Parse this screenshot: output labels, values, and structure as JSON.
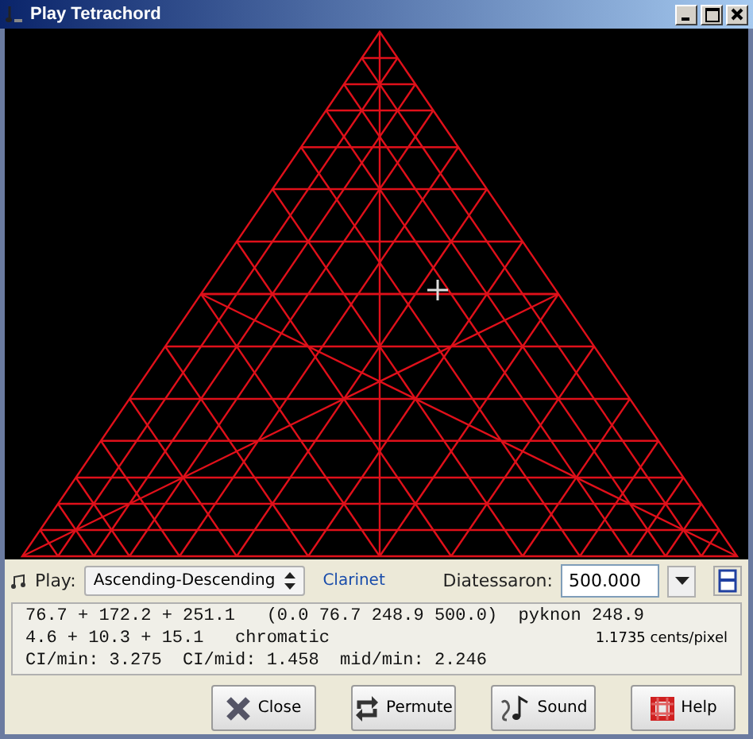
{
  "window": {
    "title": "Play Tetrachord"
  },
  "controls": {
    "play_label": "Play:",
    "mode": "Ascending-Descending",
    "instrument": "Clarinet",
    "diatessaron_label": "Diatessaron:",
    "diatessaron_value": "500.000"
  },
  "info": {
    "lines": [
      "76.7 + 172.2 + 251.1   (0.0 76.7 248.9 500.0)  pyknon 248.9",
      "4.6 + 10.3 + 15.1   chromatic",
      "CI/min: 3.275  CI/mid: 1.458  mid/min: 2.246"
    ],
    "scale": "1.1735 cents/pixel"
  },
  "buttons": [
    {
      "label": "Close",
      "kind": "close"
    },
    {
      "label": "Permute",
      "kind": "permute"
    },
    {
      "label": "Sound",
      "kind": "sound"
    },
    {
      "label": "Help",
      "kind": "help"
    }
  ]
}
